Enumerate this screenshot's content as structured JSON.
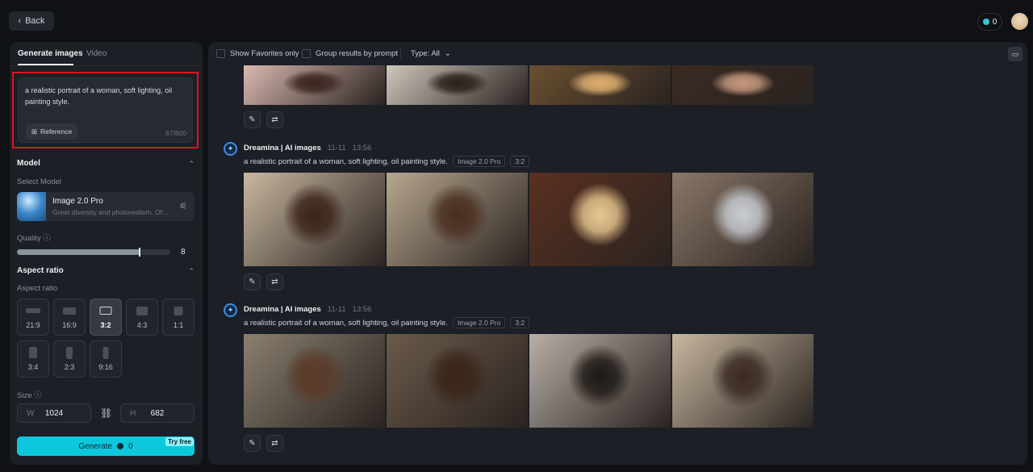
{
  "header": {
    "back_label": "Back",
    "credits": "0"
  },
  "left": {
    "tabs": [
      {
        "label": "Generate images"
      },
      {
        "label": "Video"
      }
    ],
    "prompt": {
      "value": "a realistic portrait of a woman, soft lighting, oil painting style.",
      "count": "67/800",
      "reference_label": "Reference"
    },
    "model": {
      "section": "Model",
      "select_label": "Select Model",
      "name": "Image 2.0 Pro",
      "desc": "Great diversity and photorealism. Of..."
    },
    "quality": {
      "label": "Quality",
      "value": "8",
      "max": 10
    },
    "aspect": {
      "section": "Aspect ratio",
      "label": "Aspect ratio",
      "options": [
        "21:9",
        "16:9",
        "3:2",
        "4:3",
        "1:1",
        "3:4",
        "2:3",
        "9:16"
      ],
      "selected": "3:2"
    },
    "size": {
      "label": "Size",
      "w_key": "W",
      "w": "1024",
      "h_key": "H",
      "h": "682"
    },
    "generate": {
      "label": "Generate",
      "cost": "0",
      "badge": "Try free"
    }
  },
  "main": {
    "toolbar": {
      "favorites": "Show Favorites only",
      "group": "Group results by prompt",
      "type": "Type: All"
    },
    "groups": [
      {
        "name": "Dreamina | AI images",
        "date": "11-11",
        "time": "13:56",
        "prompt": "a realistic portrait of a woman, soft lighting, oil painting style.",
        "model": "Image 2.0 Pro",
        "ratio": "3:2"
      },
      {
        "name": "Dreamina | AI images",
        "date": "11-11",
        "time": "13:56",
        "prompt": "a realistic portrait of a woman, soft lighting, oil painting style.",
        "model": "Image 2.0 Pro",
        "ratio": "3:2"
      }
    ]
  },
  "colors": {
    "accent": "#0dc8dc",
    "highlight": "#e0141e",
    "panel": "#1c1f26"
  }
}
